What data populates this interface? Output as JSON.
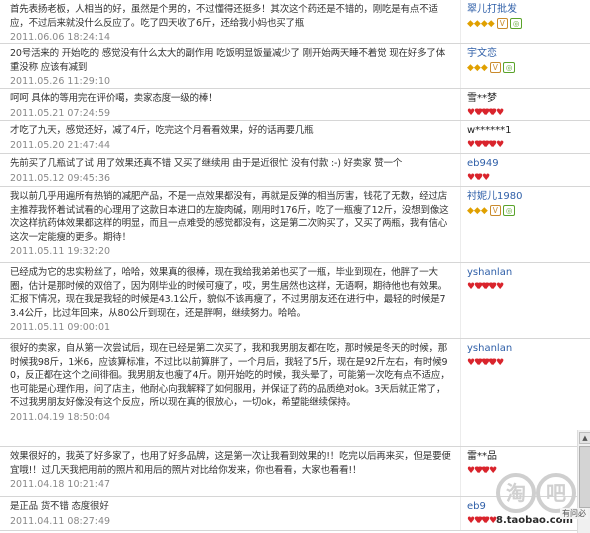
{
  "reviews": [
    {
      "text": "首先表扬老板，人相当的好，虽然是个男的，不过懂得还挺多！其次这个药还是不错的，刚吃是有点不适应，不过后来就没什么反应了。吃了四天收了6斤，还给我小妈也买了瓶",
      "date": "2011.06.06 18:24:14",
      "user": "翠儿打批发",
      "badges": "diamond×4 + tags"
    },
    {
      "text": "20号活来的 开始吃的 感觉没有什么太大的副作用 吃饭明显饭量减少了 刚开始两天睡不着觉 现在好多了体重没称 应该有减到",
      "date": "2011.05.26 11:29:10",
      "user": "宇文恋",
      "badges": "diamond×3 + tags"
    },
    {
      "text": "呵呵 具体的等用完在评价噶，卖家态度一级的棒！",
      "date": "2011.05.21 07:24:59",
      "user": "雪**梦",
      "badges": "heart×4"
    },
    {
      "text": "才吃了九天，感觉还好，减了4斤，吃完这个月看看效果，好的话再要几瓶",
      "date": "2011.05.20 21:47:44",
      "user": "w******1",
      "badges": "heart×4"
    },
    {
      "text": "先前买了几瓶试了试 用了效果还真不错 又买了继续用 由于是近很忙 没有付款 :-) 好卖家 赞一个",
      "date": "2011.05.12 09:45:36",
      "user": "eb949",
      "badges": "heart×2"
    },
    {
      "text": "我以前几乎用遍所有热销的减肥产品，不是一点效果都没有，再就是反弹的相当厉害，钱花了无数，经过店主推荐我怀着试试看的心理用了这款日本进口的左旋肉碱，刚用时176斤，吃了一瓶瘦了12斤，没想到像这次这样抗药体效果都这样的明显，而且一点难受的感觉都没有，这是第二次购买了，又买了两瓶，我有信心这次一定能瘦的更多。期待！",
      "date": "2011.05.11 19:32:20",
      "user": "衬妮儿1980",
      "badges": "diamond×3 + tags"
    },
    {
      "text": "已经成为它的忠实粉丝了，哈哈，效果真的很棒，现在我给我弟弟也买了一瓶，毕业到现在，他胖了一大圈，估计是那时候的双倍了，因为刚毕业的时候可瘦了，哎，男生居然也这样，无语啊，期待他也有效果。汇报下情况，现在我是我轻的时候是43.1公斤，貌似不该再瘦了，不过男朋友还在进行中，最轻的时候是73.4公斤，比过年回来，从80公斤到现在，还是胖啊，继续努力。哈哈。",
      "date": "2011.05.11 09:00:01",
      "user": "yshanlan",
      "badges": "heart×4"
    },
    {
      "text": "很好的卖家，自从第一次尝试后，现在已经是第二次买了，我和我男朋友都在吃，那时候是冬天的时候，那时候我98斤，1米6，应该算标准，不过比以前算胖了，一个月后，我轻了5斤，现在是92斤左右，有时候90，反正都在这个之间徘徊。我男朋友也瘦了4斤。刚开始吃的时候，我头晕了，可能第一次吃有点不适应，也可能是心理作用，问了店主，他耐心向我解释了如何服用，并保证了药的品质绝对ok。3天后就正常了，不过我男朋友好像没有这个反应，所以现在真的很放心，一切ok，希望能继续保持。",
      "date": "2011.04.19 18:50:04",
      "user": "yshanlan",
      "badges": "heart×4"
    },
    {
      "text": "效果很好的，我英了好多家了，也用了好多品牌，这是第一次让我看到效果的!！吃完以后再来买，但是要便宜哦!！过几天我把用前的照片和用后的照片对比给你发来，你也看看，大家也看看!！",
      "date": "2011.04.18 10:21:47",
      "user": "雷**品",
      "badges": "heart×3"
    },
    {
      "text": "是正品 货不错 态度很好",
      "date": "2011.04.11 08:27:49",
      "user": "eb9",
      "badges": "heart×3"
    }
  ],
  "watermark": {
    "logo_text": "淘吧",
    "url": "8.taobao.com"
  },
  "corner_note": "有问必"
}
